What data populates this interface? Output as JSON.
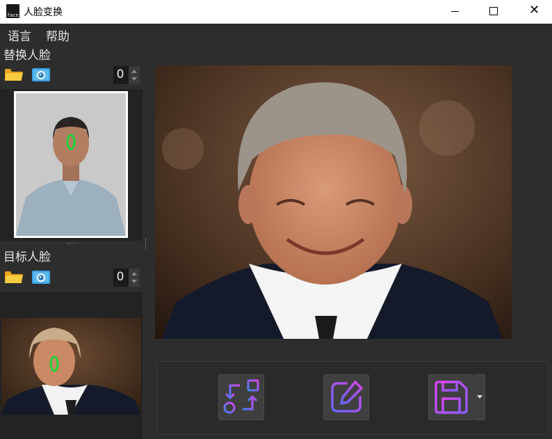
{
  "window": {
    "title": "人脸变换",
    "app_icon_text": "face"
  },
  "menu": {
    "items": [
      {
        "label": "语言"
      },
      {
        "label": "帮助"
      }
    ]
  },
  "source_panel": {
    "label": "替换人脸",
    "count": "0"
  },
  "target_panel": {
    "label": "目标人脸",
    "count": "0"
  },
  "icons": {
    "open": "folder-icon",
    "camera": "camera-icon",
    "swap": "swap-icon",
    "edit": "edit-icon",
    "save": "save-icon"
  },
  "colors": {
    "background": "#2d2d2d",
    "panel": "#232323",
    "face_marker": "#22d33a",
    "icon_gradient_start": "#3b82f6",
    "icon_gradient_end": "#d946ef",
    "folder": "#f6c12f",
    "camera": "#3aa3e3"
  }
}
